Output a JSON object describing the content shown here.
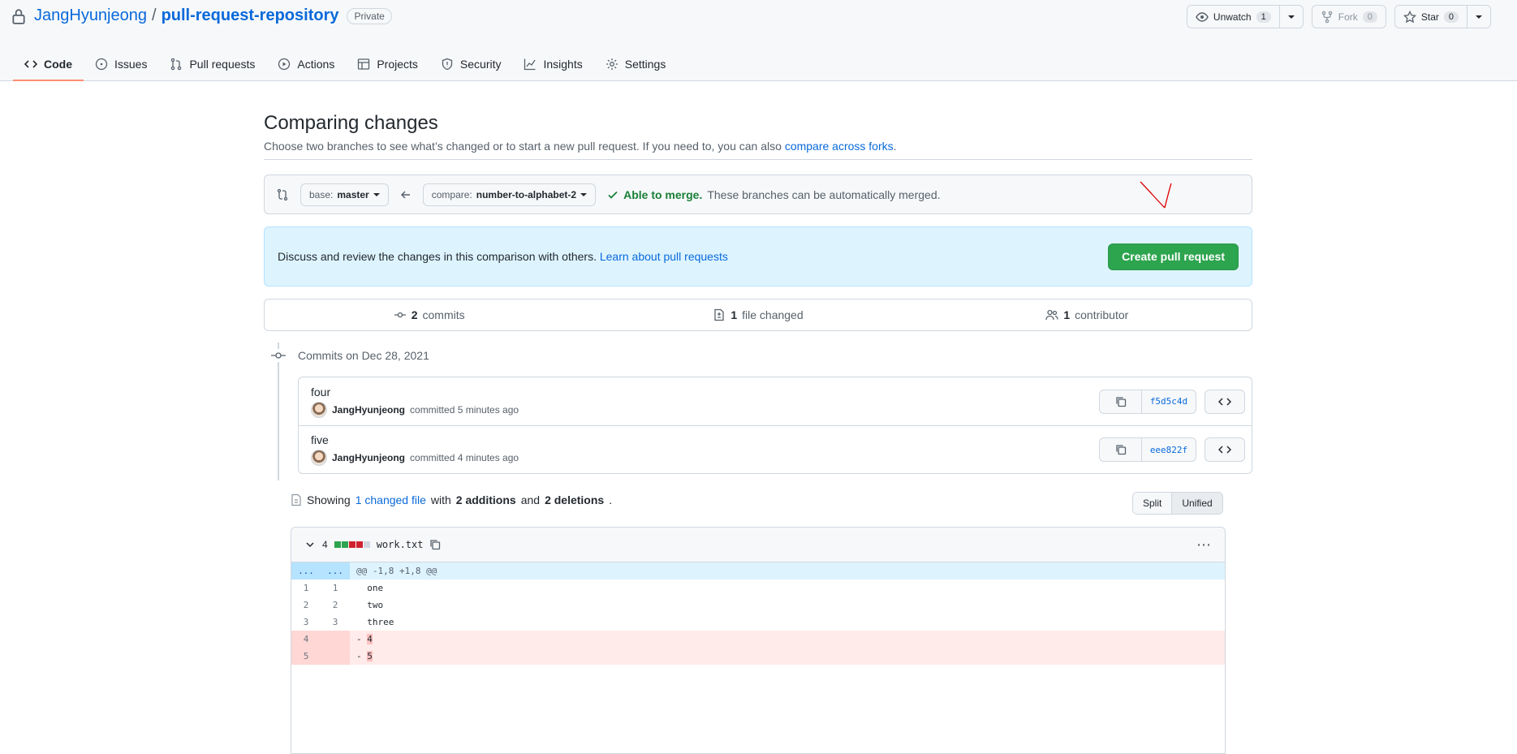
{
  "header": {
    "owner": "JangHyunjeong",
    "separator": "/",
    "repo": "pull-request-repository",
    "visibility": "Private",
    "unwatch_label": "Unwatch",
    "watch_count": "1",
    "fork_label": "Fork",
    "fork_count": "0",
    "star_label": "Star",
    "star_count": "0"
  },
  "nav": {
    "tabs": [
      {
        "label": "Code",
        "icon": "code-icon"
      },
      {
        "label": "Issues",
        "icon": "issue-icon"
      },
      {
        "label": "Pull requests",
        "icon": "pull-request-icon"
      },
      {
        "label": "Actions",
        "icon": "play-icon"
      },
      {
        "label": "Projects",
        "icon": "table-icon"
      },
      {
        "label": "Security",
        "icon": "shield-icon"
      },
      {
        "label": "Insights",
        "icon": "graph-icon"
      },
      {
        "label": "Settings",
        "icon": "gear-icon"
      }
    ],
    "selected": "Code"
  },
  "compare": {
    "title": "Comparing changes",
    "desc_prefix": "Choose two branches to see what’s changed or to start a new pull request. If you need to, you can also",
    "desc_link": "compare across forks",
    "desc_suffix": ".",
    "base_prefix": "base:",
    "base_branch": "master",
    "compare_prefix": "compare:",
    "compare_branch": "number-to-alphabet-2",
    "merge_ok": "Able to merge.",
    "merge_text": "These branches can be automatically merged.",
    "flash_text": "Discuss and review the changes in this comparison with others.",
    "flash_link": "Learn about pull requests",
    "create_button": "Create pull request"
  },
  "summary": {
    "commits_count": "2",
    "commits_label": "commits",
    "files_count": "1",
    "files_label": "file changed",
    "contributors_count": "1",
    "contributors_label": "contributor"
  },
  "commits": {
    "date_label": "Commits on Dec 28, 2021",
    "items": [
      {
        "message": "four",
        "author": "JangHyunjeong",
        "meta": "committed 5 minutes ago",
        "sha": "f5d5c4d"
      },
      {
        "message": "five",
        "author": "JangHyunjeong",
        "meta": "committed 4 minutes ago",
        "sha": "eee822f"
      }
    ]
  },
  "diff": {
    "showing_prefix": "Showing",
    "showing_link": "1 changed file",
    "showing_with": "with",
    "additions": "2 additions",
    "and": "and",
    "deletions": "2 deletions",
    "period": ".",
    "split_label": "Split",
    "unified_label": "Unified",
    "file_changes": "4",
    "file_name": "work.txt",
    "hunk_ln": "...",
    "hunk_header": "@@ -1,8 +1,8 @@",
    "lines": [
      {
        "old": "1",
        "new": "1",
        "sign": " ",
        "text": "one",
        "type": "ctx"
      },
      {
        "old": "2",
        "new": "2",
        "sign": " ",
        "text": "two",
        "type": "ctx"
      },
      {
        "old": "3",
        "new": "3",
        "sign": " ",
        "text": "three",
        "type": "ctx"
      },
      {
        "old": "4",
        "new": "",
        "sign": "-",
        "text": "4",
        "type": "del"
      },
      {
        "old": "5",
        "new": "",
        "sign": "-",
        "text": "5",
        "type": "del"
      }
    ]
  },
  "colors": {
    "accent": "#0969da",
    "primary_button": "#2da44e",
    "selected_tab_underline": "#fd8c73",
    "deletion_bg": "#ffebe9",
    "flash_bg": "#ddf4ff",
    "annotation_red": "#e00000"
  }
}
